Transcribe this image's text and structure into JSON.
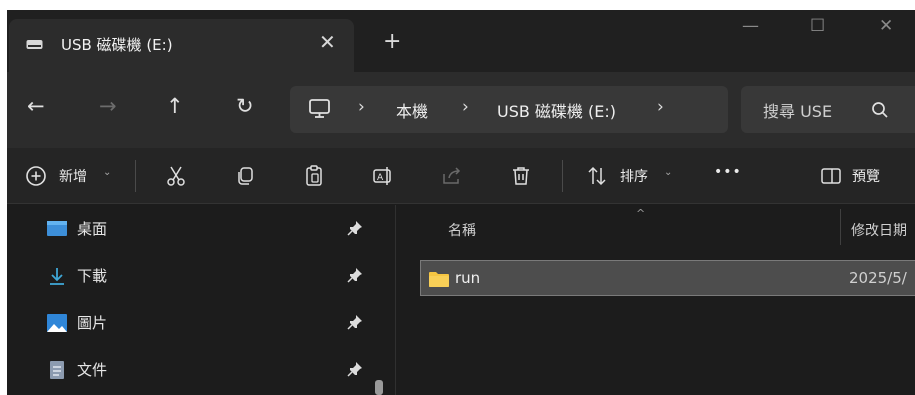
{
  "tab": {
    "title": "USB 磁碟機 (E:)",
    "close": "✕",
    "new_tab": "+"
  },
  "window_controls": {
    "minimize": "—",
    "maximize": "☐",
    "close": "✕"
  },
  "nav": {
    "back": "←",
    "forward": "→",
    "up": "↑",
    "refresh": "↻"
  },
  "breadcrumb": {
    "items": [
      "本機",
      "USB 磁碟機 (E:)"
    ],
    "separator": "›"
  },
  "search": {
    "placeholder": "搜尋 USE"
  },
  "commands": {
    "new_label": "新增",
    "sort_label": "排序",
    "more_label": "•••",
    "preview_label": "預覽",
    "dropdown": "⌄"
  },
  "sidebar": {
    "items": [
      {
        "label": "桌面",
        "icon": "desktop-icon"
      },
      {
        "label": "下載",
        "icon": "download-icon"
      },
      {
        "label": "圖片",
        "icon": "pictures-icon"
      },
      {
        "label": "文件",
        "icon": "documents-icon"
      }
    ]
  },
  "filelist": {
    "columns": {
      "name": "名稱",
      "modified": "修改日期"
    },
    "sort_indicator": "^",
    "rows": [
      {
        "name": "run",
        "modified": "2025/5/",
        "type": "folder"
      }
    ]
  },
  "colors": {
    "window_bg": "#1c1c1c",
    "titlebar_bg": "#202020",
    "addressbar_bg": "#2c2c2c",
    "selected_row": "#4d4d4d",
    "folder_yellow": "#f5c542",
    "accent_blue": "#4aa0e6"
  }
}
